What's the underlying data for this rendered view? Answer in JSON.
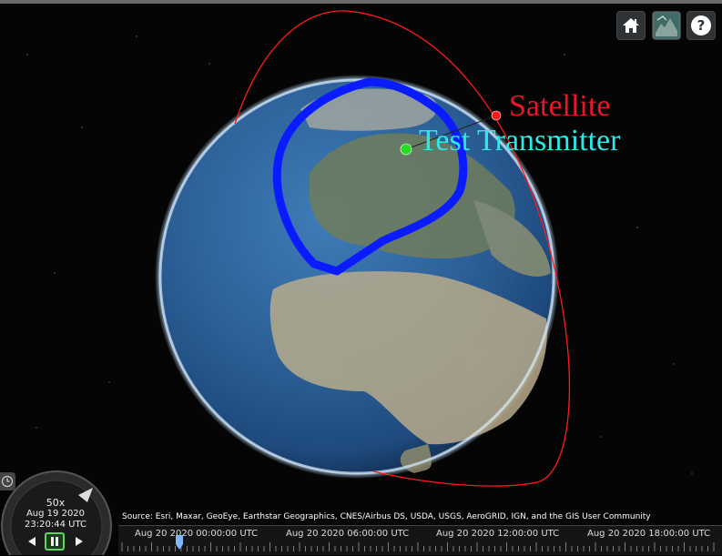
{
  "toolbar": {
    "home_icon": "home-icon",
    "basemap_icon": "basemap-picker-icon",
    "help_icon": "help-icon",
    "help_glyph": "?"
  },
  "labels": {
    "satellite": "Satellite",
    "transmitter": "Test Transmitter"
  },
  "colors": {
    "satellite": "#e8162a",
    "transmitter_label": "#2ee8e8",
    "transmitter_marker": "#22dd22",
    "coverage": "#0a1cff",
    "orbit": "#ff1a1a"
  },
  "animation": {
    "speed": "50x",
    "date": "Aug 19 2020",
    "time": "23:20:44 UTC",
    "state": "playing"
  },
  "credits": "Source: Esri, Maxar, GeoEye, Earthstar Geographics, CNES/Airbus DS, USDA, USGS, AeroGRID, IGN, and the GIS User Community",
  "timeline": {
    "labels": [
      "Aug 20 2020 00:00:00 UTC",
      "Aug 20 2020 06:00:00 UTC",
      "Aug 20 2020 12:00:00 UTC",
      "Aug 20 2020 18:00:00 UTC"
    ]
  }
}
